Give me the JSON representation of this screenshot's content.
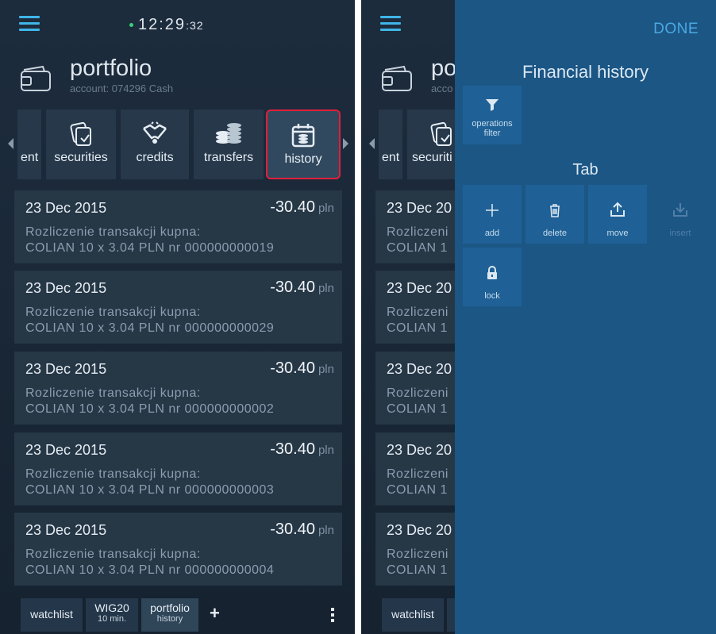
{
  "status": {
    "time_main": "12:29",
    "time_sec": ":32"
  },
  "account": {
    "title": "portfolio",
    "subtitle": "account: 074296 Cash",
    "title_clipped": "po",
    "subtitle_clipped": "acco"
  },
  "tabs": [
    {
      "label": "ent",
      "icon": "partial-tab"
    },
    {
      "label": "securities",
      "icon": "securities-icon"
    },
    {
      "label": "credits",
      "icon": "handshake-icon"
    },
    {
      "label": "transfers",
      "icon": "coins-icon"
    },
    {
      "label": "history",
      "icon": "calendar-history-icon",
      "active": true
    }
  ],
  "tabs_right": [
    {
      "label": "ent"
    },
    {
      "label": "securiti"
    }
  ],
  "transactions": [
    {
      "date": "23 Dec 2015",
      "amount": "-30.40",
      "currency": "pln",
      "line1": "Rozliczenie transakcji kupna:",
      "line2": "COLIAN 10 x 3.04 PLN nr 000000000019",
      "date_clipped": "23 Dec 20",
      "line1_clipped": "Rozliczeni",
      "line2_clipped": "COLIAN 1"
    },
    {
      "date": "23 Dec 2015",
      "amount": "-30.40",
      "currency": "pln",
      "line1": "Rozliczenie transakcji kupna:",
      "line2": "COLIAN 10 x 3.04 PLN nr 000000000029",
      "date_clipped": "23 Dec 20",
      "line1_clipped": "Rozliczeni",
      "line2_clipped": "COLIAN 1"
    },
    {
      "date": "23 Dec 2015",
      "amount": "-30.40",
      "currency": "pln",
      "line1": "Rozliczenie transakcji kupna:",
      "line2": "COLIAN 10 x 3.04 PLN nr 000000000002",
      "date_clipped": "23 Dec 20",
      "line1_clipped": "Rozliczeni",
      "line2_clipped": "COLIAN 1"
    },
    {
      "date": "23 Dec 2015",
      "amount": "-30.40",
      "currency": "pln",
      "line1": "Rozliczenie transakcji kupna:",
      "line2": "COLIAN 10 x 3.04 PLN nr 000000000003",
      "date_clipped": "23 Dec 20",
      "line1_clipped": "Rozliczeni",
      "line2_clipped": "COLIAN 1"
    },
    {
      "date": "23 Dec 2015",
      "amount": "-30.40",
      "currency": "pln",
      "line1": "Rozliczenie transakcji kupna:",
      "line2": "COLIAN 10 x 3.04 PLN nr 000000000004",
      "date_clipped": "23 Dec 20",
      "line1_clipped": "Rozliczeni",
      "line2_clipped": "COLIAN 1"
    }
  ],
  "bottom_tabs": [
    {
      "label": "watchlist",
      "sub": ""
    },
    {
      "label": "WIG20",
      "sub": "10 min."
    },
    {
      "label": "portfolio",
      "sub": "history"
    }
  ],
  "panel": {
    "done": "DONE",
    "title": "Financial history",
    "filter_label_1": "operations",
    "filter_label_2": "filter",
    "section": "Tab",
    "actions": [
      {
        "label": "add",
        "icon": "plus-icon",
        "enabled": true
      },
      {
        "label": "delete",
        "icon": "trash-icon",
        "enabled": true
      },
      {
        "label": "move",
        "icon": "upload-icon",
        "enabled": true
      },
      {
        "label": "insert",
        "icon": "download-icon",
        "enabled": false
      }
    ],
    "lock_label": "lock"
  },
  "colors": {
    "accent": "#3fb6e8",
    "highlight": "#e0203a",
    "panel": "#1b5685",
    "card": "#263746"
  }
}
